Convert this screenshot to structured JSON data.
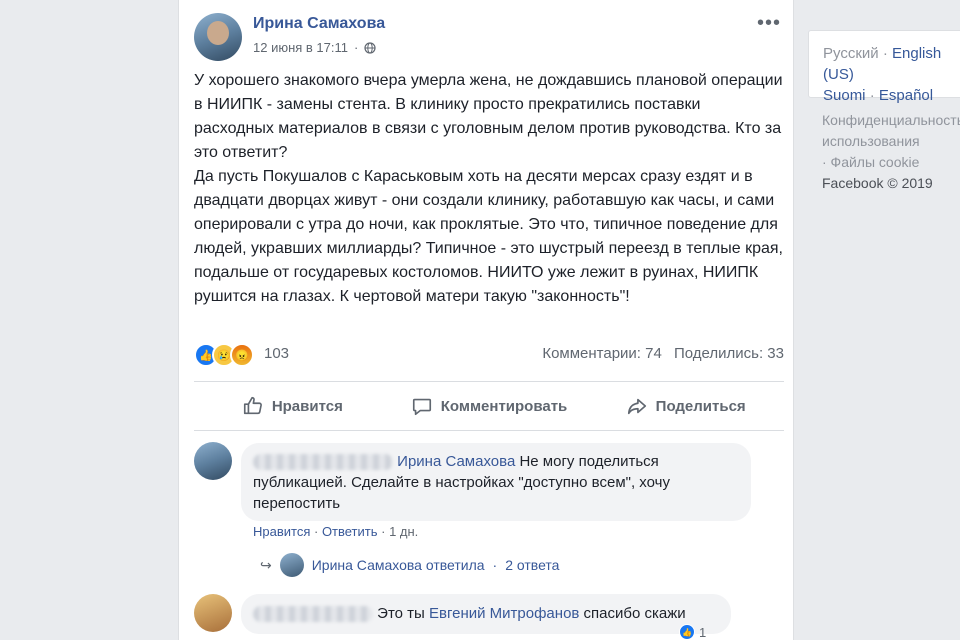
{
  "post": {
    "author": "Ирина Самахова",
    "time": "12 июня в 17:11",
    "paragraphs": [
      "У хорошего знакомого вчера умерла жена, не дождавшись плановой операции в НИИПК - замены стента. В клинику просто прекратились поставки расходных материалов в связи с уголовным делом против руководства. Кто за это ответит?",
      "Да пусть Покушалов с Караськовым хоть на десяти мерсах сразу ездят и в двадцати дворцах живут - они создали клинику, работавшую как часы, и сами оперировали с утра до ночи, как проклятые. Это что, типичное поведение для людей, укравших миллиарды? Типичное - это шустрый переезд в теплые края, подальше от государевых костоломов. НИИТО уже лежит в руинах, НИИПК рушится на глазах. К чертовой матери такую \"законность\"!"
    ],
    "reaction_count": "103",
    "comments_stat": "Комментарии: 74",
    "shares_stat": "Поделились: 33"
  },
  "actions": {
    "like": "Нравится",
    "comment": "Комментировать",
    "share": "Поделиться"
  },
  "comments": [
    {
      "mention": "Ирина Самахова",
      "text": "Не могу поделиться публикацией. Сделайте в настройках \"доступно всем\", хочу перепостить",
      "like": "Нравится",
      "reply": "Ответить",
      "age": "1 дн.",
      "replies_text": "Ирина Самахова ответила",
      "replies_count": "2 ответа"
    },
    {
      "text": "Это ты",
      "mention": "Евгений Митрофанов",
      "text_after": "спасибо скажи",
      "likes": "1"
    }
  ],
  "sidebar": {
    "lang_current": "Русский",
    "languages": [
      "English (US)",
      "Suomi",
      "Español"
    ],
    "footer_lines": [
      "Конфиденциальность",
      "использования",
      "· Файлы cookie"
    ],
    "copyright": "Facebook © 2019"
  }
}
